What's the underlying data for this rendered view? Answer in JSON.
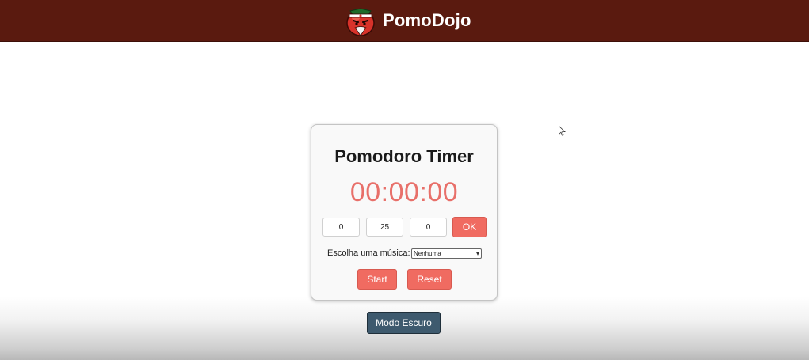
{
  "header": {
    "app_name": "PomoDojo",
    "logo_icon": "tomato-samurai-icon",
    "background_color": "#5a1a0f"
  },
  "timer_card": {
    "title": "Pomodoro Timer",
    "display": "00:00:00",
    "display_color": "#e8706a",
    "inputs": {
      "hours": "0",
      "minutes": "25",
      "seconds": "0"
    },
    "ok_label": "OK",
    "music": {
      "label": "Escolha uma música:",
      "selected": "Nenhuma"
    },
    "start_label": "Start",
    "reset_label": "Reset"
  },
  "dark_mode_label": "Modo Escuro",
  "colors": {
    "accent_red": "#f06b61",
    "dark_mode_button": "#3e5a6e"
  }
}
